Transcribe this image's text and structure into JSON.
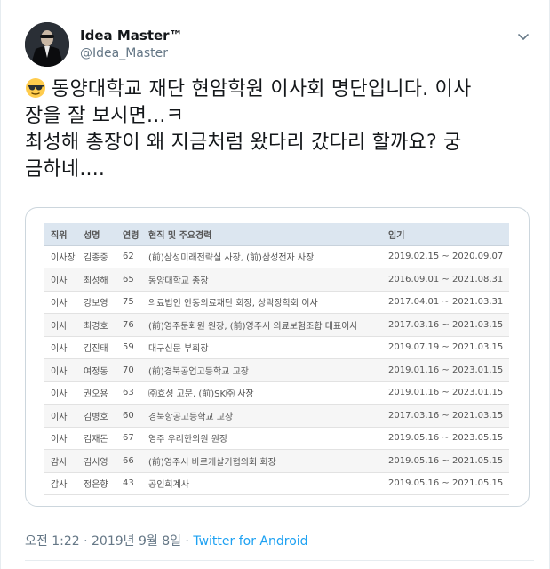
{
  "user": {
    "display_name": "Idea Master™",
    "handle": "@Idea_Master"
  },
  "tweet": {
    "emoji": "sunglasses-emoji",
    "line1": "동양대학교 재단 현암학원 이사회 명단입니다. 이사",
    "line2": "장을 잘 보시면...ㅋ",
    "line3": "최성해 총장이 왜 지금처럼 왔다리 갔다리 할까요? 궁",
    "line4": "금하네...."
  },
  "table": {
    "headers": [
      "직위",
      "성명",
      "연령",
      "현직 및 주요경력",
      "임기"
    ],
    "rows": [
      [
        "이사장",
        "김종중",
        "62",
        "(前)삼성미래전략실 사장, (前)삼성전자 사장",
        "2019.02.15 ~ 2020.09.07"
      ],
      [
        "이사",
        "최성해",
        "65",
        "동양대학교 총장",
        "2016.09.01 ~ 2021.08.31"
      ],
      [
        "이사",
        "강보영",
        "75",
        "의료법인 안동의료재단 회장, 상락장학회 이사",
        "2017.04.01 ~ 2021.03.31"
      ],
      [
        "이사",
        "최경호",
        "76",
        "(前)영주문화원 원장, (前)영주시 의료보험조합 대표이사",
        "2017.03.16 ~ 2021.03.15"
      ],
      [
        "이사",
        "김진태",
        "59",
        "대구신문 부회장",
        "2019.07.19 ~ 2021.03.15"
      ],
      [
        "이사",
        "여정동",
        "70",
        "(前)경북공업고등학교 교장",
        "2019.01.16 ~ 2023.01.15"
      ],
      [
        "이사",
        "권오용",
        "63",
        "㈜효성 고문, (前)SK㈜ 사장",
        "2019.01.16 ~ 2023.01.15"
      ],
      [
        "이사",
        "김병호",
        "60",
        "경북항공고등학교 교장",
        "2017.03.16 ~ 2021.03.15"
      ],
      [
        "이사",
        "김재돈",
        "67",
        "영주 우리한의원 원장",
        "2019.05.16 ~ 2023.05.15"
      ],
      [
        "감사",
        "김시영",
        "66",
        "(前)영주시 바르게살기협의회 회장",
        "2019.05.16 ~ 2021.05.15"
      ],
      [
        "감사",
        "정은향",
        "43",
        "공인회계사",
        "2019.05.16 ~ 2021.05.15"
      ]
    ]
  },
  "meta": {
    "timestamp": "오전 1:22 · 2019년 9월 8일 · ",
    "source": "Twitter for Android"
  },
  "icons": {
    "caret": "chevron-down-icon",
    "avatar": "avatar"
  },
  "colors": {
    "link": "#1da1f2",
    "secondary_text": "#657786",
    "table_header": "#dce6f0"
  }
}
